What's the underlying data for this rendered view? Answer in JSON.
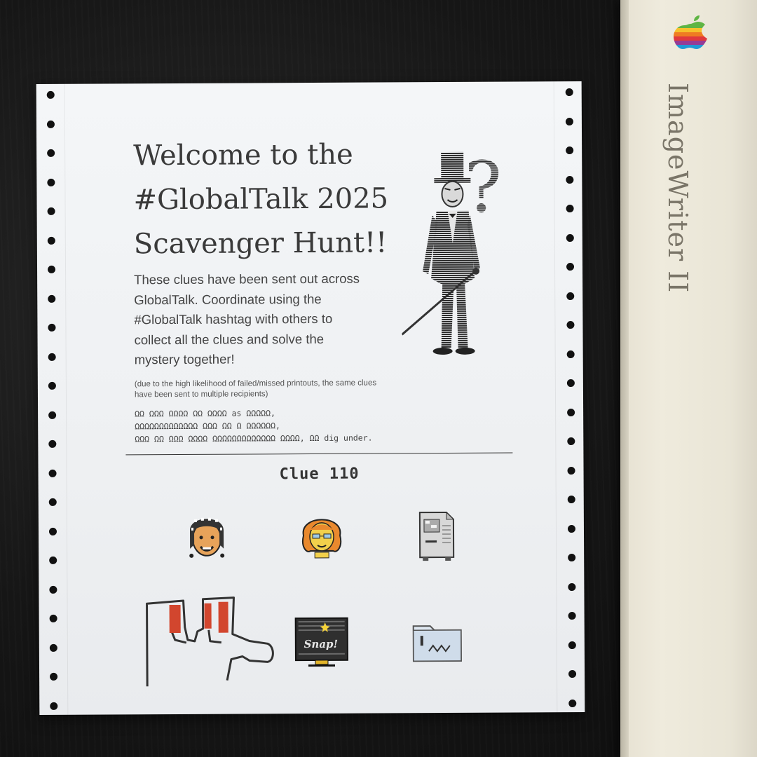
{
  "printer": {
    "label": "ImageWriter II",
    "logo_icon": "rainbow-apple-logo-icon"
  },
  "page": {
    "title_lines": [
      "Welcome to the",
      "#GlobalTalk 2025",
      "Scavenger Hunt!!"
    ],
    "intro_lines": [
      "These clues have been sent out across",
      "GlobalTalk. Coordinate using the",
      "#GlobalTalk hashtag with others to",
      "collect all the clues and solve the",
      "mystery together!"
    ],
    "note_lines": [
      "(due to the high likelihood of failed/missed printouts, the same clues",
      "have been sent to multiple recipients)"
    ],
    "cipher_lines": [
      "ΩΩ ΩΩΩ ΩΩΩΩ ΩΩ ΩΩΩΩ as ΩΩΩΩΩ,",
      "ΩΩΩΩΩΩΩΩΩΩΩΩΩ ΩΩΩ ΩΩ Ω ΩΩΩΩΩΩ,",
      "ΩΩΩ ΩΩ ΩΩΩ ΩΩΩΩ ΩΩΩΩΩΩΩΩΩΩΩΩΩ ΩΩΩΩ, ΩΩ dig under."
    ],
    "clue_label": "Clue 110",
    "snap_label": "Snap!",
    "icons": [
      "bearded-man-face-icon",
      "orange-haired-woman-face-icon",
      "compact-mac-icon",
      "glove-hand-drawing-icon",
      "snap-tv-icon",
      "folder-icon"
    ],
    "illustration": "ringmaster-top-hat-question-mark-icon",
    "colors": {
      "paper": "#f0f2f4",
      "ink": "#3a3a3a",
      "desk": "#161616",
      "printer": "#ebe7d8"
    }
  }
}
